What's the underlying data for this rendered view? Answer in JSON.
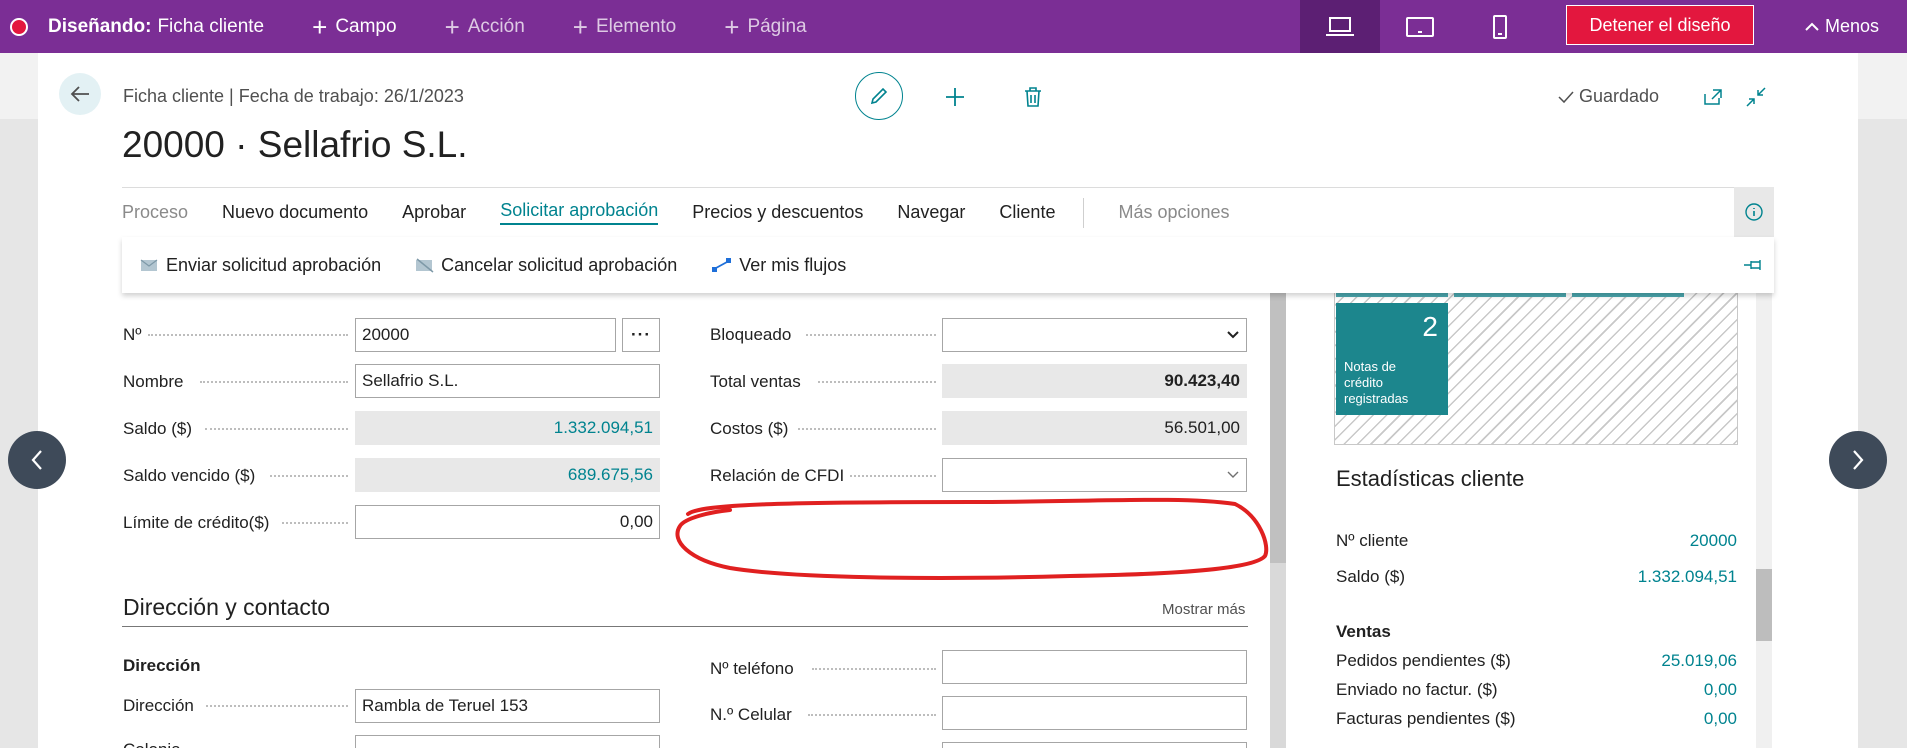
{
  "topbar": {
    "designing_label": "Diseñando:",
    "page_name": "Ficha cliente",
    "add_items": [
      "Campo",
      "Acción",
      "Elemento",
      "Página"
    ],
    "stop_button": "Detener el diseño",
    "less_label": "Menos",
    "accent_color": "#7b2e95",
    "stop_color": "#e3173e"
  },
  "header": {
    "breadcrumb": "Ficha cliente | Fecha de trabajo: 26/1/2023",
    "title": "20000 · Sellafrio S.L.",
    "saved_label": "Guardado"
  },
  "actions": {
    "tabs": [
      "Proceso",
      "Nuevo documento",
      "Aprobar",
      "Solicitar aprobación",
      "Precios y descuentos",
      "Navegar",
      "Cliente"
    ],
    "more_options": "Más opciones",
    "sub_actions": [
      "Enviar solicitud aprobación",
      "Cancelar solicitud aprobación",
      "Ver mis flujos"
    ]
  },
  "general": {
    "left": [
      {
        "label": "Nº",
        "value": "20000"
      },
      {
        "label": "Nombre",
        "value": "Sellafrio S.L."
      },
      {
        "label": "Saldo ($)",
        "value": "1.332.094,51"
      },
      {
        "label": "Saldo vencido ($)",
        "value": "689.675,56"
      },
      {
        "label": "Límite de crédito($)",
        "value": "0,00"
      }
    ],
    "right": [
      {
        "label": "Bloqueado",
        "value": ""
      },
      {
        "label": "Total ventas",
        "value": "90.423,40"
      },
      {
        "label": "Costos ($)",
        "value": "56.501,00"
      },
      {
        "label": "Relación de CFDI",
        "value": ""
      }
    ]
  },
  "address_section": {
    "title": "Dirección y contacto",
    "show_more": "Mostrar más",
    "group_title": "Dirección",
    "address_label": "Dirección",
    "address_value": "Rambla de Teruel 153",
    "phone_label": "Nº teléfono",
    "mobile_label": "N.º Celular",
    "next_label": "Colonia"
  },
  "factbox": {
    "tile_count": "2",
    "tile_label": "Notas de crédito registradas",
    "stats_title": "Estadísticas cliente",
    "customer_no_label": "Nº cliente",
    "customer_no_value": "20000",
    "balance_label": "Saldo ($)",
    "balance_value": "1.332.094,51",
    "sales_heading": "Ventas",
    "sales": [
      {
        "label": "Pedidos pendientes ($)",
        "value": "25.019,06"
      },
      {
        "label": "Enviado no factur. ($)",
        "value": "0,00"
      },
      {
        "label": "Facturas pendientes ($)",
        "value": "0,00"
      }
    ]
  }
}
